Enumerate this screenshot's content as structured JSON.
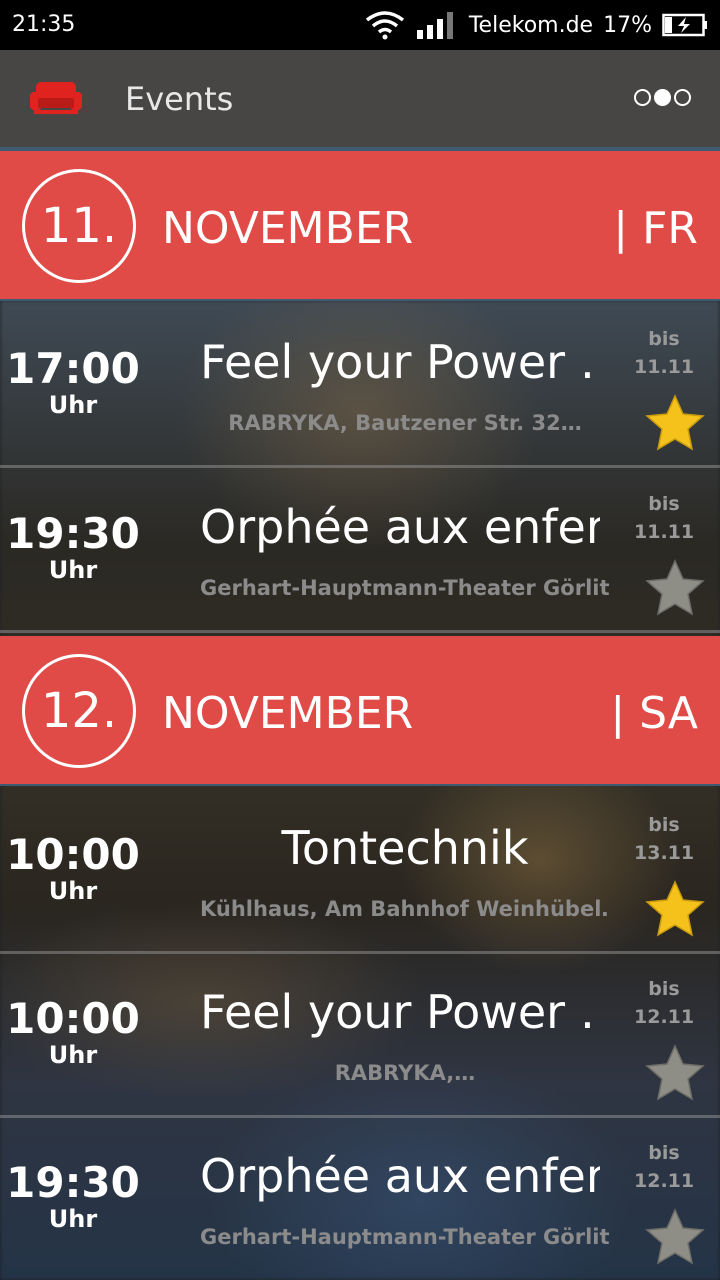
{
  "status_bar": {
    "time": "21:35",
    "carrier": "Telekom.de",
    "battery": "17%"
  },
  "app_bar": {
    "title": "Events",
    "menu_icon": "overflow-dots-icon",
    "logo_icon": "sofa-icon"
  },
  "colors": {
    "accent": "#e04b47",
    "appbar": "#484645",
    "star_active": "#f5c21b",
    "star_inactive": "#8e8e86"
  },
  "days": [
    {
      "day": "11.",
      "month": "NOVEMBER",
      "weekday": "| FR",
      "events": [
        {
          "time": "17:00",
          "unit": "Uhr",
          "title": "Feel your Power  …",
          "location": "RABRYKA, Bautzener Str. 32…",
          "until_label": "bis",
          "until_date": "11.11",
          "favorite": true
        },
        {
          "time": "19:30",
          "unit": "Uhr",
          "title": "Orphée aux enfer…",
          "location": "Gerhart-Hauptmann-Theater Görlitz…",
          "until_label": "bis",
          "until_date": "11.11",
          "favorite": false
        }
      ]
    },
    {
      "day": "12.",
      "month": "NOVEMBER",
      "weekday": "| SA",
      "events": [
        {
          "time": "10:00",
          "unit": "Uhr",
          "title": "Tontechnik",
          "location": "Kühlhaus, Am Bahnhof Weinhübel…",
          "until_label": "bis",
          "until_date": "13.11",
          "favorite": true
        },
        {
          "time": "10:00",
          "unit": "Uhr",
          "title": "Feel your Power  …",
          "location": "RABRYKA,…",
          "until_label": "bis",
          "until_date": "12.11",
          "favorite": false
        },
        {
          "time": "19:30",
          "unit": "Uhr",
          "title": "Orphée aux enfer…",
          "location": "Gerhart-Hauptmann-Theater Görlitz…",
          "until_label": "bis",
          "until_date": "12.11",
          "favorite": false
        }
      ]
    }
  ]
}
